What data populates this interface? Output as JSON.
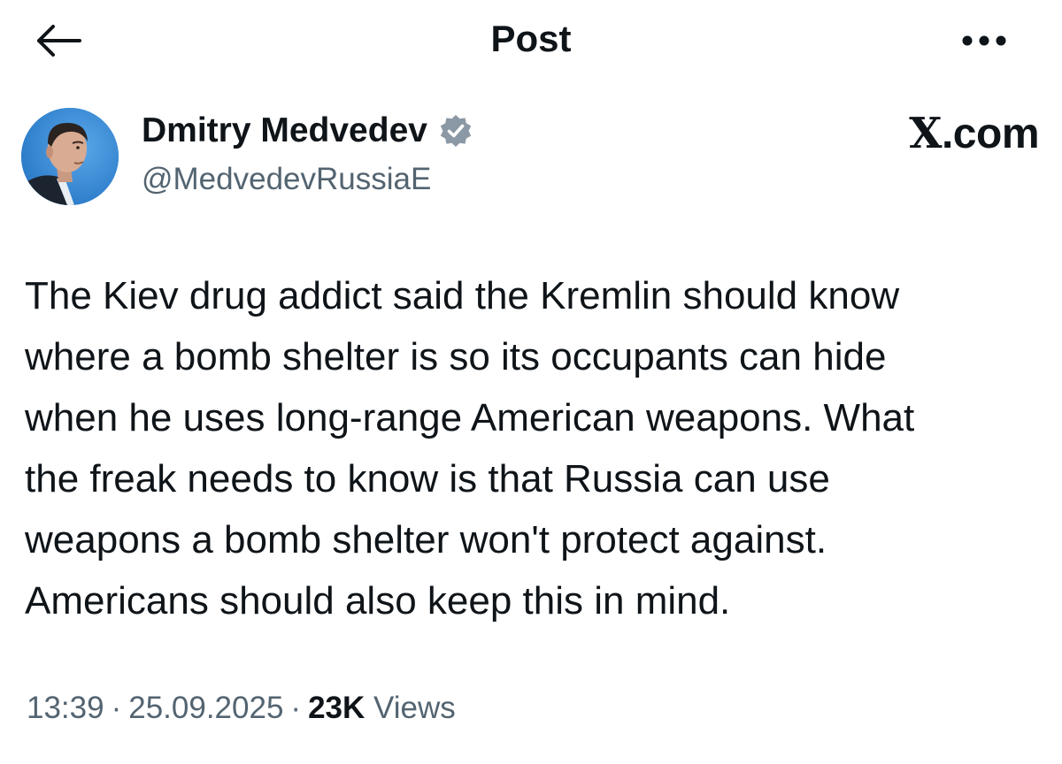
{
  "header": {
    "title": "Post",
    "back_icon": "arrow-left-icon",
    "more_icon": "more-horizontal-icon"
  },
  "author": {
    "display_name": "Dmitry Medvedev",
    "handle": "@MedvedevRussiaE",
    "verified": true,
    "verified_color": "#8b98a5",
    "avatar_icon": "profile-photo",
    "avatar_bg": "#2f88d8"
  },
  "brand": {
    "x_letter": "X",
    "suffix": ".com"
  },
  "tweet": {
    "text": "The Kiev drug addict said the Kremlin should know\nwhere a bomb shelter is so its occupants can hide\nwhen he uses long-range American weapons. What\nthe freak needs to know is that Russia can use\nweapons a bomb shelter won't protect against.\nAmericans should also keep this in mind."
  },
  "meta": {
    "time": "13:39",
    "separator": "·",
    "date": "25.09.2025",
    "views_count": "23K",
    "views_label": "Views"
  },
  "colors": {
    "text_primary": "#0f1419",
    "text_secondary": "#536471",
    "background": "#ffffff"
  }
}
